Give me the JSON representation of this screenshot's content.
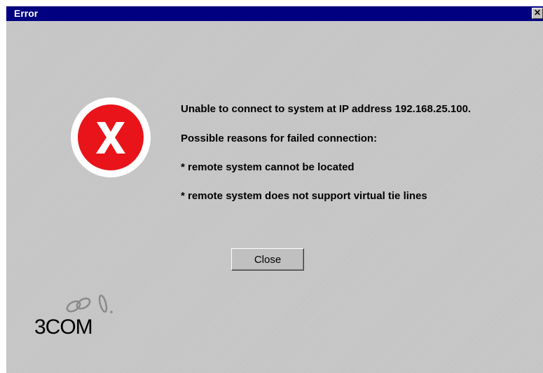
{
  "window": {
    "title": "Error",
    "close_glyph": "✕"
  },
  "icon": "error-icon",
  "messages": {
    "line1": "Unable to connect to system at IP address 192.168.25.100.",
    "line2": "Possible reasons for failed connection:",
    "line3": "* remote system cannot be located",
    "line4": "* remote system does not support virtual tie lines"
  },
  "buttons": {
    "close_label": "Close"
  },
  "logo": {
    "text": "3COM"
  },
  "colors": {
    "titlebar": "#000080",
    "dialog_bg": "#c0c0c0",
    "error_red": "#e8141a"
  }
}
